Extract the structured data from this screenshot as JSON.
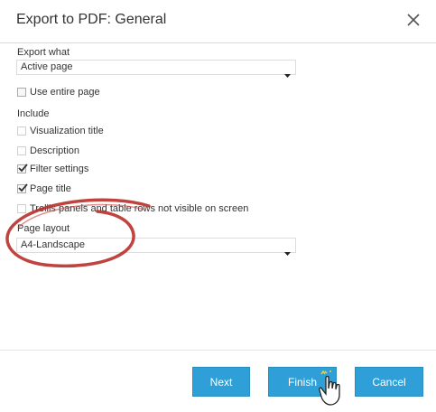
{
  "dialog": {
    "title": "Export to PDF: General",
    "close_icon": "close-icon"
  },
  "export_what": {
    "label": "Export what",
    "selected": "Active page"
  },
  "use_entire_page": {
    "label": "Use entire page",
    "checked": false
  },
  "include": {
    "label": "Include",
    "options": [
      {
        "label": "Visualization title",
        "checked": false,
        "enabled": false
      },
      {
        "label": "Description",
        "checked": false,
        "enabled": false
      },
      {
        "label": "Filter settings",
        "checked": true,
        "enabled": true
      },
      {
        "label": "Page title",
        "checked": true,
        "enabled": true
      },
      {
        "label": "Trellis panels and table rows not visible on screen",
        "checked": false,
        "enabled": false
      }
    ]
  },
  "page_layout": {
    "label": "Page layout",
    "selected": "A4-Landscape"
  },
  "buttons": {
    "next": "Next",
    "finish": "Finish",
    "cancel": "Cancel"
  },
  "colors": {
    "button_bg": "#2f9fd8",
    "annotation": "#b8302a"
  }
}
